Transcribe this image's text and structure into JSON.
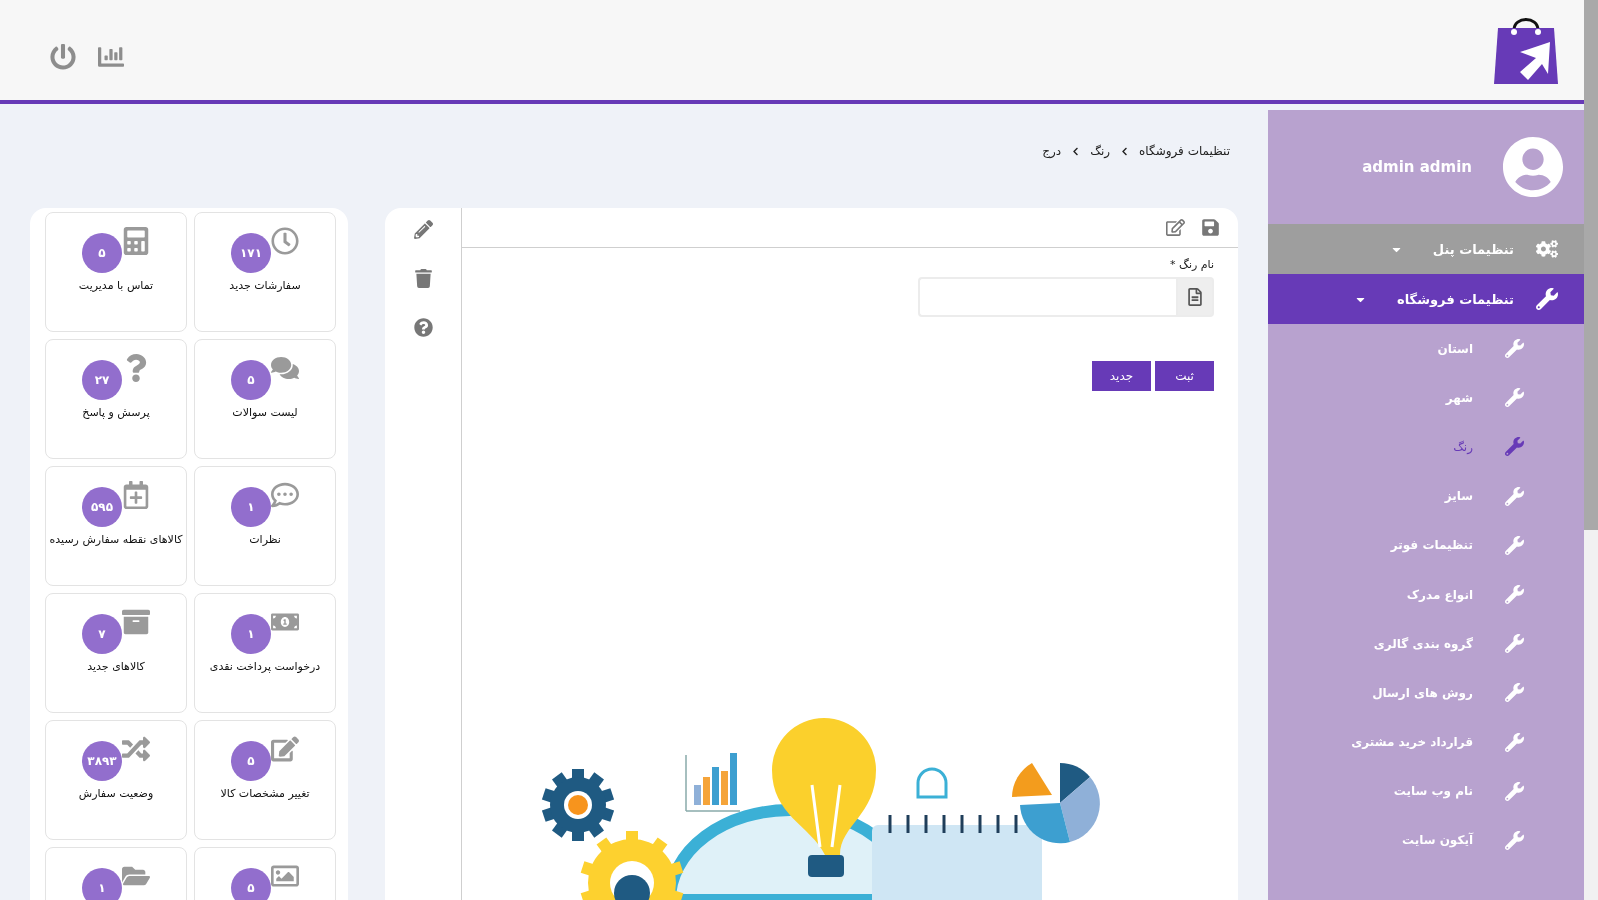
{
  "header": {
    "tools": [
      {
        "kind": "power"
      },
      {
        "kind": "chart"
      }
    ]
  },
  "breadcrumb": [
    "تنظیمات فروشگاه",
    "رنگ",
    "درج"
  ],
  "toolbar": [
    {
      "kind": "save"
    },
    {
      "kind": "edit"
    }
  ],
  "side_tools": [
    {
      "kind": "pencil"
    },
    {
      "kind": "trash"
    },
    {
      "kind": "help"
    }
  ],
  "form": {
    "label": "نام رنگ",
    "required": "*",
    "buttons": [
      "ثبت",
      "جدید"
    ]
  },
  "tiles": [
    {
      "label": "سفارشات جدید",
      "count": "۱۷۱",
      "kind": "clock"
    },
    {
      "label": "تماس با مدیریت",
      "count": "۵",
      "kind": "calculator"
    },
    {
      "label": "لیست سوالات",
      "count": "۵",
      "kind": "chats"
    },
    {
      "label": "پرسش و پاسخ",
      "count": "۲۷",
      "kind": "question"
    },
    {
      "label": "نظرات",
      "count": "۱",
      "kind": "comment"
    },
    {
      "label": "کالاهای نقطه سفارش رسیده",
      "count": "۵۹۵",
      "kind": "calendar"
    },
    {
      "label": "درخواست پرداخت نقدی",
      "count": "۱",
      "kind": "money"
    },
    {
      "label": "کالاهای جدید",
      "count": "۷",
      "kind": "archive"
    },
    {
      "label": "تغییر مشخصات کالا",
      "count": "۵",
      "kind": "edit"
    },
    {
      "label": "وضعیت سفارش",
      "count": "۳۸۹۳",
      "kind": "shuffle"
    },
    {
      "count": "۵",
      "kind": "image"
    },
    {
      "count": "۱",
      "kind": "folder"
    }
  ],
  "user": {
    "name": "admin admin"
  },
  "menu": [
    {
      "label": "تنظیمات پنل",
      "kind": "gears",
      "selected": false
    },
    {
      "label": "تنظیمات فروشگاه",
      "kind": "wrench",
      "selected": true,
      "children": [
        {
          "label": "استان",
          "selected": false
        },
        {
          "label": "شهر",
          "selected": false
        },
        {
          "label": "رنگ",
          "selected": true
        },
        {
          "label": "سایز",
          "selected": false
        },
        {
          "label": "تنظیمات فوتر",
          "selected": false
        },
        {
          "label": "انواع مدرک",
          "selected": false
        },
        {
          "label": "گروه بندی گالری",
          "selected": false
        },
        {
          "label": "روش های ارسال",
          "selected": false
        },
        {
          "label": "قرارداد خرید مشتری",
          "selected": false
        },
        {
          "label": "نام وب سایت",
          "selected": false
        },
        {
          "label": "آیکون سایت",
          "selected": false
        }
      ]
    }
  ]
}
